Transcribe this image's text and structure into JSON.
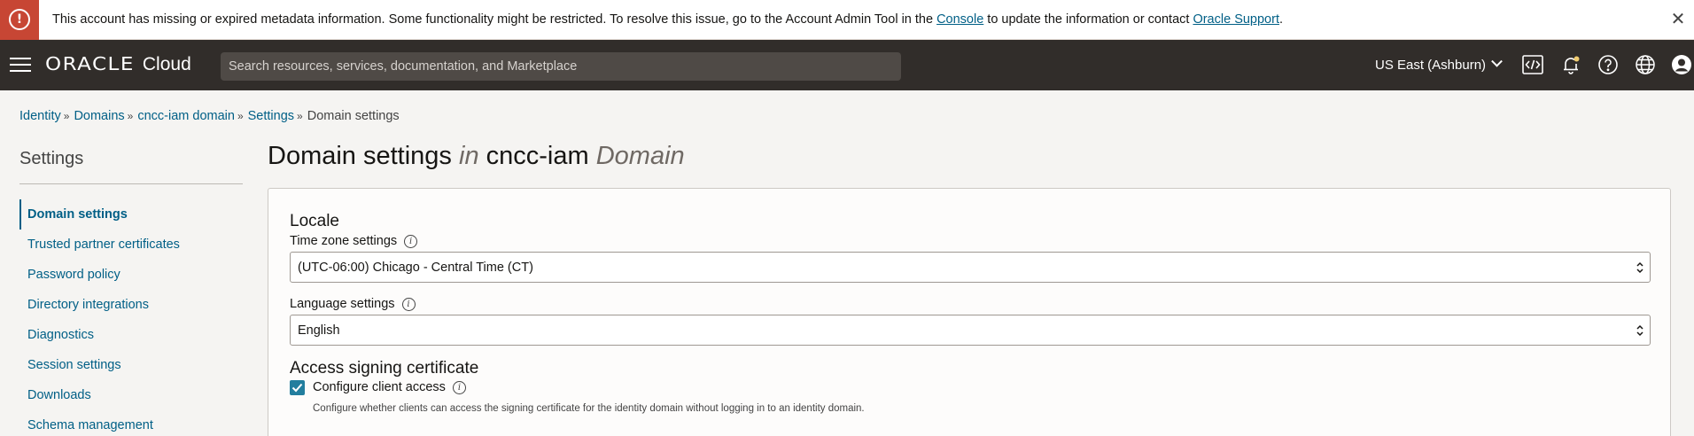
{
  "banner": {
    "text_before": "This account has missing or expired metadata information. Some functionality might be restricted. To resolve this issue, go to the Account Admin Tool in the ",
    "console_link": "Console",
    "text_middle": " to update the information or contact ",
    "support_link": "Oracle Support",
    "text_after": ".",
    "error_glyph": "!",
    "close_glyph": "✕"
  },
  "topnav": {
    "brand_oracle": "ORACLE",
    "brand_cloud": "Cloud",
    "search_placeholder": "Search resources, services, documentation, and Marketplace",
    "region": "US East (Ashburn)",
    "icons": [
      "code-editor-icon",
      "notification-bell-icon",
      "help-icon",
      "language-globe-icon",
      "profile-icon"
    ]
  },
  "breadcrumb": {
    "items": [
      "Identity",
      "Domains",
      "cncc-iam domain",
      "Settings"
    ],
    "separator": "»",
    "current": "Domain settings"
  },
  "sidebar": {
    "title": "Settings",
    "items": [
      {
        "label": "Domain settings",
        "active": true
      },
      {
        "label": "Trusted partner certificates"
      },
      {
        "label": "Password policy"
      },
      {
        "label": "Directory integrations"
      },
      {
        "label": "Diagnostics"
      },
      {
        "label": "Session settings"
      },
      {
        "label": "Downloads"
      },
      {
        "label": "Schema management"
      }
    ]
  },
  "main": {
    "title_part1": "Domain settings",
    "title_in": "in",
    "title_domain_name": "cncc-iam",
    "title_domain_word": "Domain",
    "locale": {
      "heading": "Locale",
      "timezone_label": "Time zone settings",
      "timezone_value": "(UTC-06:00) Chicago - Central Time (CT)",
      "language_label": "Language settings",
      "language_value": "English"
    },
    "access_signing": {
      "heading": "Access signing certificate",
      "checkbox_label": "Configure client access",
      "checked": true,
      "helper": "Configure whether clients can access the signing certificate for the identity domain without logging in to an identity domain."
    }
  },
  "colors": {
    "error": "#c74634",
    "nav_bg": "#312d2a",
    "link": "#005f86",
    "checkbox": "#227e9e"
  }
}
